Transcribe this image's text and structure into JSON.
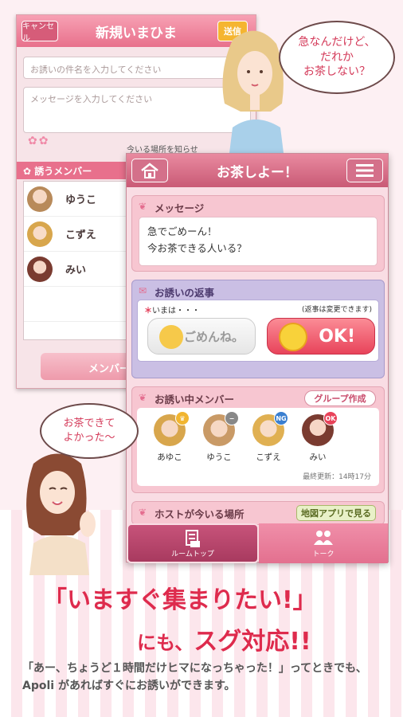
{
  "back_screen": {
    "title": "新規いまひま",
    "cancel_label": "キャンセル",
    "send_label": "送信",
    "subject_placeholder": "お誘いの件名を入力してください",
    "message_placeholder": "メッセージを入力してください",
    "location_label": "今いる場所を知らせ",
    "members_header": "誘うメンバー",
    "members": [
      {
        "name": "ゆうこ"
      },
      {
        "name": "こずえ"
      },
      {
        "name": "みい"
      }
    ],
    "member_button_label": "メンバー"
  },
  "bubbles": {
    "top": "急なんだけど、\nだれか\nお茶しない？",
    "bottom": "お茶できて\nよかった〜"
  },
  "front_screen": {
    "title": "お茶しよー！",
    "message_section": {
      "title": "メッセージ",
      "line1": "急でごめーん！",
      "line2": "今お茶できる人いる？"
    },
    "reply_section": {
      "title": "お誘いの返事",
      "now_label": "いまは・・・",
      "note": "(返事は変更できます)",
      "sorry_label": "ごめんね。",
      "ok_label": "OK!"
    },
    "invite_section": {
      "title": "お誘い中メンバー",
      "group_button": "グループ作成",
      "members": [
        {
          "name": "あゆこ",
          "badge": "crown"
        },
        {
          "name": "ゆうこ",
          "badge": "−"
        },
        {
          "name": "こずえ",
          "badge": "NG"
        },
        {
          "name": "みい",
          "badge": "OK"
        }
      ],
      "updated": "最終更新：14時17分"
    },
    "host_section": {
      "title": "ホストが今いる場所",
      "map_button": "地図アプリで見る"
    },
    "tabs": [
      {
        "label": "ルームトップ",
        "icon": "room-top-icon"
      },
      {
        "label": "トーク",
        "icon": "talk-icon"
      }
    ]
  },
  "headline": {
    "line1": "「いますぐ集まりたい!」",
    "line2_small": "にも、",
    "line2_big": "スグ対応!!"
  },
  "description": "「あー、ちょうど１時間だけヒマになっちゃった！」ってときでも、Apoli があればすぐにお誘いができます。",
  "colors": {
    "accent": "#de2b4d",
    "header_pink": "#e8708c",
    "reply_purple": "#cabfe4"
  }
}
